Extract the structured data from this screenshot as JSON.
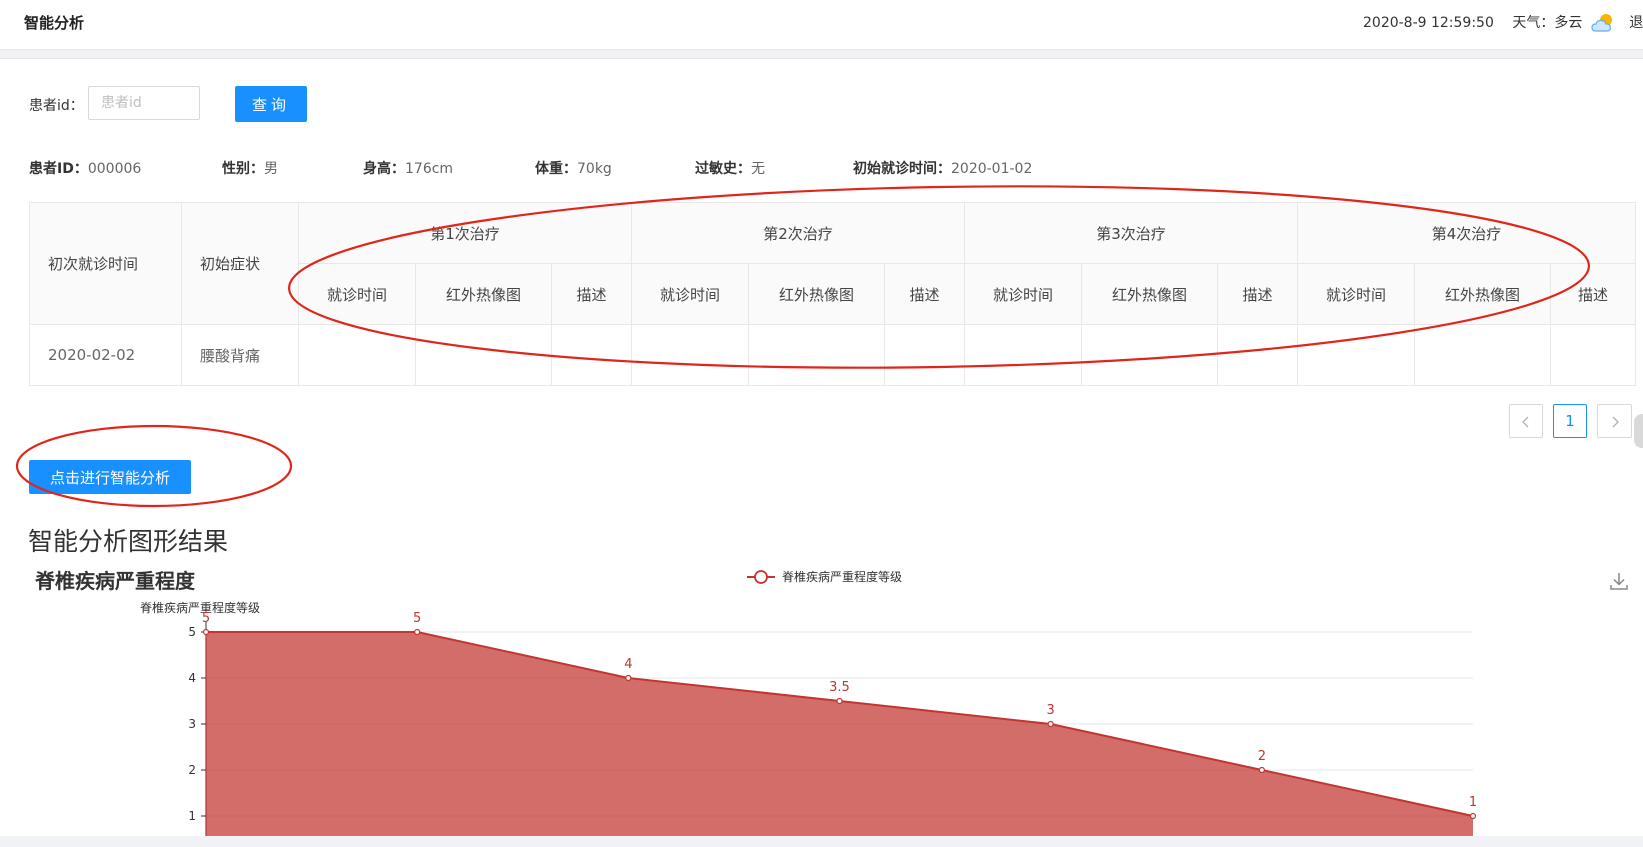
{
  "header": {
    "title": "智能分析",
    "datetime": "2020-8-9 12:59:50",
    "weather_label": "天气：多云",
    "weather_icon": "partly-cloudy-icon",
    "trailing_text": "退"
  },
  "search": {
    "label": "患者id：",
    "placeholder": "患者id",
    "value": "",
    "button_label": "查询"
  },
  "patient": {
    "id_label": "患者ID：",
    "id_value": "000006",
    "gender_label": "性别：",
    "gender_value": "男",
    "height_label": "身高：",
    "height_value": "176cm",
    "weight_label": "体重：",
    "weight_value": "70kg",
    "allergy_label": "过敏史：",
    "allergy_value": "无",
    "first_visit_label": "初始就诊时间：",
    "first_visit_value": "2020-01-02"
  },
  "table": {
    "col_first_visit": "初次就诊时间",
    "col_symptom": "初始症状",
    "treatments": [
      {
        "label": "第1次治疗"
      },
      {
        "label": "第2次治疗"
      },
      {
        "label": "第3次治疗"
      },
      {
        "label": "第4次治疗"
      }
    ],
    "sub_visit_time": "就诊时间",
    "sub_thermal": "红外热像图",
    "sub_desc": "描述",
    "rows": [
      {
        "first_visit": "2020-02-02",
        "symptom": "腰酸背痛"
      }
    ]
  },
  "pagination": {
    "prev_icon": "chevron-left-icon",
    "current": "1",
    "next_icon": "chevron-right-icon"
  },
  "analyze_button": "点击进行智能分析",
  "result_title": "智能分析图形结果",
  "chart_data": {
    "type": "area",
    "title": "脊椎疾病严重程度",
    "ylabel": "脊椎疾病严重程度等级",
    "legend": "脊椎疾病严重程度等级",
    "legend_position": "top-center",
    "ylim": [
      0,
      5
    ],
    "y_ticks": [
      1,
      2,
      3,
      4,
      5
    ],
    "grid": true,
    "series": [
      {
        "name": "脊椎疾病严重程度等级",
        "values": [
          5,
          5,
          4,
          3.5,
          3,
          2,
          1
        ]
      }
    ],
    "point_labels": [
      "5",
      "5",
      "4",
      "3.5",
      "3",
      "2",
      "1"
    ],
    "color": "#c23531"
  },
  "colors": {
    "primary": "#1890ff",
    "annotation": "#e0261b",
    "area": "#c23531"
  }
}
